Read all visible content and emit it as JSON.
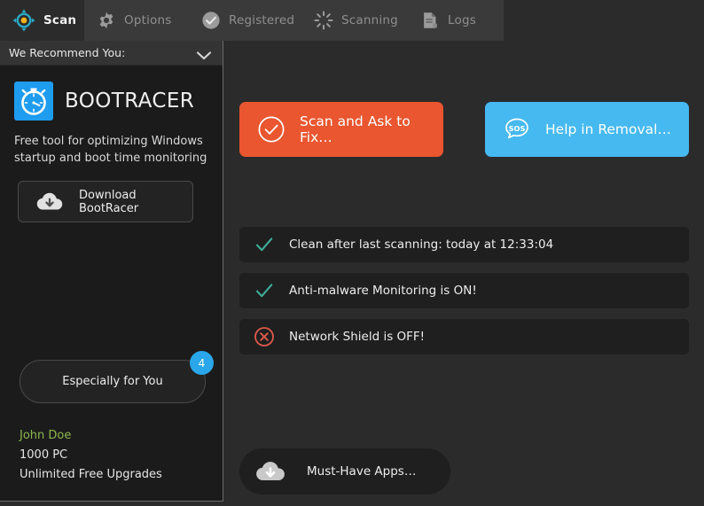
{
  "topbar": {
    "tabs": [
      {
        "label": "Scan",
        "icon": "crosshair-target-icon",
        "active": true
      },
      {
        "label": "Options",
        "icon": "gear-icon",
        "active": false
      },
      {
        "label": "Registered",
        "icon": "check-circle-icon",
        "active": false
      },
      {
        "label": "Scanning",
        "icon": "spinner-icon",
        "active": false
      },
      {
        "label": "Logs",
        "icon": "document-icon",
        "active": false
      }
    ]
  },
  "sidebar": {
    "header": {
      "title": "We Recommend You:",
      "chevron": "chevron-down-icon"
    },
    "promo": {
      "icon": "stopwatch-icon",
      "title": "BOOTRACER",
      "description": "Free tool for optimizing Windows startup and boot time monitoring",
      "download_label": "Download BootRacer",
      "download_icon": "cloud-download-icon"
    },
    "especially": {
      "label": "Especially for You",
      "badge": "4",
      "badge_color": "#29a7ea"
    },
    "user": {
      "name": "John Doe",
      "name_color": "#8cb84e",
      "license": "1000 PC",
      "upgrades": "Unlimited Free Upgrades"
    }
  },
  "main": {
    "actions": [
      {
        "label": "Scan and Ask to Fix…",
        "icon": "check-circle-outline-icon",
        "color": "#e9562f"
      },
      {
        "label": "Help in Removal…",
        "icon": "sos-bubble-icon",
        "color": "#46b9f0"
      }
    ],
    "status_rows": [
      {
        "label": "Clean after last scanning: today at 12:33:04",
        "icon": "check-icon",
        "state": "ok",
        "color": "#3fae9a"
      },
      {
        "label": "Anti-malware Monitoring is ON!",
        "icon": "check-icon",
        "state": "ok",
        "color": "#3fae9a"
      },
      {
        "label": "Network Shield is OFF!",
        "icon": "x-circle-icon",
        "state": "error",
        "color": "#e0594a"
      }
    ],
    "apps_button": {
      "label": "Must-Have Apps…",
      "icon": "cloud-download-icon"
    }
  }
}
